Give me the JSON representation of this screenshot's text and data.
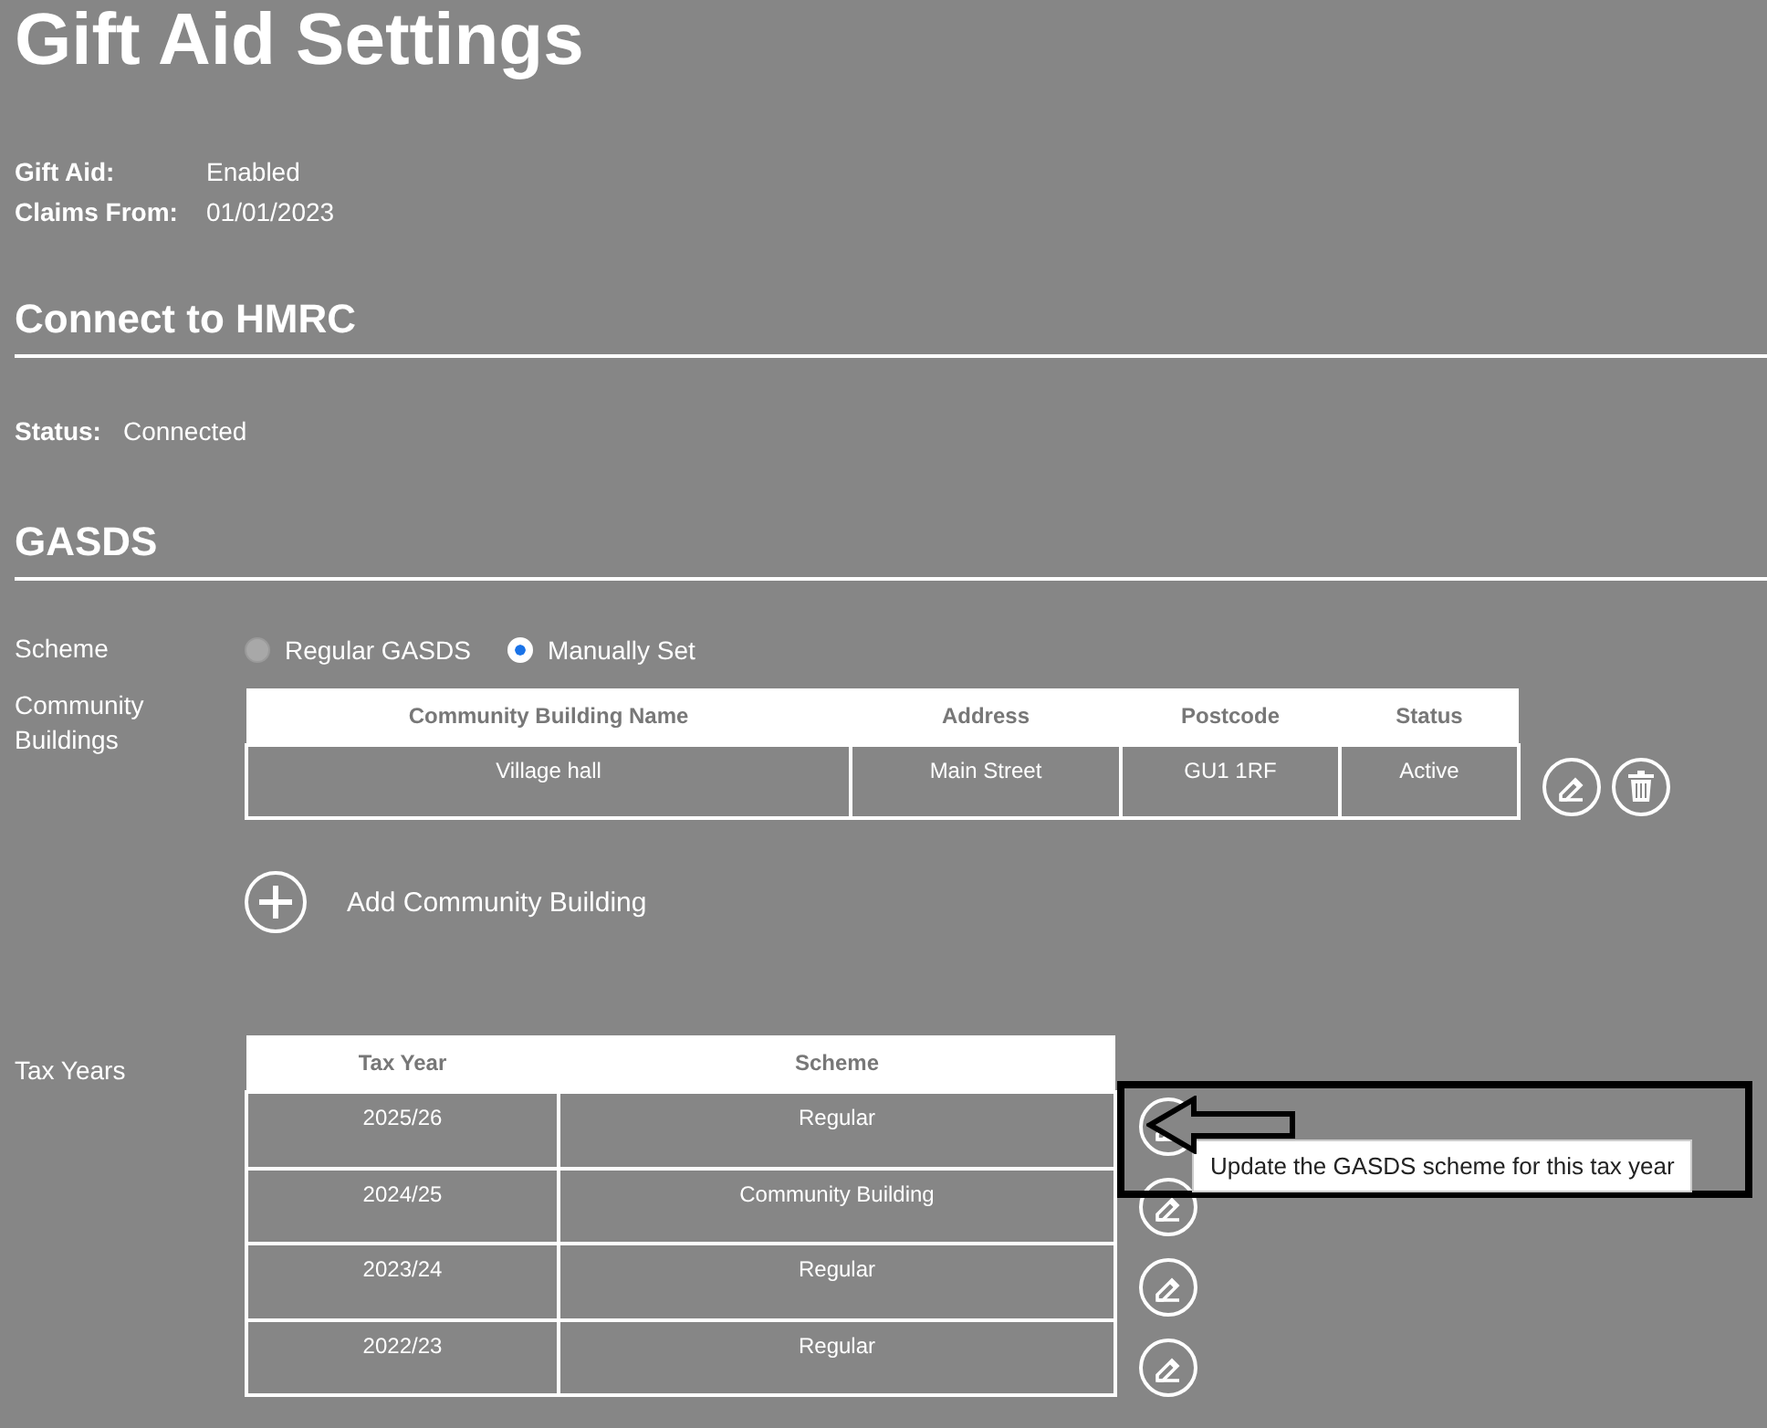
{
  "title": "Gift Aid Settings",
  "details": [
    {
      "label": "Gift Aid:",
      "value": "Enabled"
    },
    {
      "label": "Claims From:",
      "value": "01/01/2023"
    }
  ],
  "hmrc": {
    "heading": "Connect to HMRC",
    "status_label": "Status:",
    "status_value": "Connected"
  },
  "gasds": {
    "heading": "GASDS",
    "scheme_label": "Scheme",
    "scheme_options": [
      {
        "label": "Regular GASDS",
        "selected": false
      },
      {
        "label": "Manually Set",
        "selected": true
      }
    ],
    "community_label": "Community Buildings",
    "community_table": {
      "columns": [
        "Community Building Name",
        "Address",
        "Postcode",
        "Status"
      ],
      "rows": [
        [
          "Village hall",
          "Main Street",
          "GU1 1RF",
          "Active"
        ]
      ]
    },
    "add_button": "Add Community Building",
    "tax_label": "Tax Years",
    "tax_table": {
      "columns": [
        "Tax Year",
        "Scheme"
      ],
      "rows": [
        [
          "2025/26",
          "Regular"
        ],
        [
          "2024/25",
          "Community Building"
        ],
        [
          "2023/24",
          "Regular"
        ],
        [
          "2022/23",
          "Regular"
        ]
      ]
    },
    "tooltip": "Update the GASDS scheme for this tax year"
  }
}
